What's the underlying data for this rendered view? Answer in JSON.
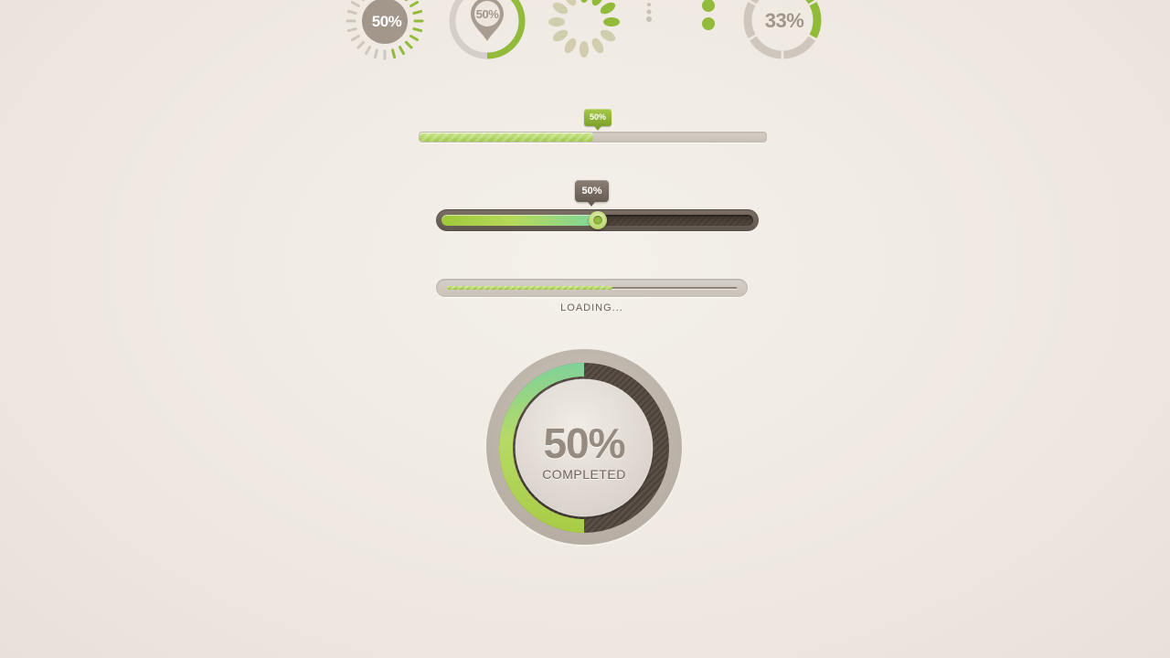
{
  "spinners": {
    "dashed": {
      "label": "50%",
      "progress": 0.5
    },
    "pin": {
      "label": "50%",
      "progress": 0.5
    },
    "ring": {
      "label": "33%",
      "progress": 0.33
    }
  },
  "slider_thin": {
    "tooltip": "50%",
    "value": 0.5
  },
  "slider_dark": {
    "tooltip": "50%",
    "value": 0.5
  },
  "loading": {
    "label": "LOADING...",
    "progress": 0.57
  },
  "donut": {
    "percent_label": "50%",
    "status_label": "COMPLETED",
    "progress": 0.5
  },
  "colors": {
    "accent_green": "#93bb3a",
    "track_beige": "#cfc7be",
    "dark_brown": "#5f544c",
    "text_taupe": "#968b80"
  }
}
